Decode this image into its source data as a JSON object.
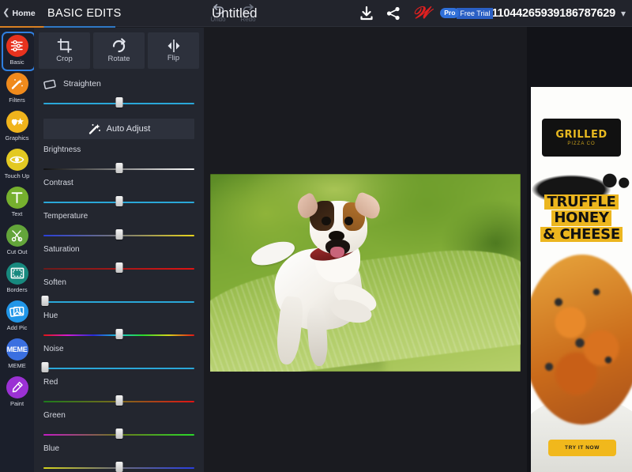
{
  "topbar": {
    "home_label": "Home",
    "home_chevron": "chevron-left-icon",
    "panel_title": "BASIC EDITS",
    "undo_label": "Undo",
    "redo_label": "Redo",
    "document_title": "Untitled",
    "download_icon": "download-icon",
    "share_icon": "share-icon",
    "brand_logo": "w-logo",
    "pro_badge": "Pro",
    "trial_label": "Free Trial",
    "account_number": "111044265939186787629",
    "caret": "chevron-down-icon",
    "accent_orange": "#d98023",
    "accent_blue": "#2f78c4"
  },
  "sidebar": {
    "items": [
      {
        "label": "Basic",
        "icon": "sliders-icon",
        "color": "#e8321e",
        "active": true
      },
      {
        "label": "Filters",
        "icon": "magic-wand-icon",
        "color": "#f08a1c",
        "active": false
      },
      {
        "label": "Graphics",
        "icon": "star-heart-icon",
        "color": "#f0b41c",
        "active": false
      },
      {
        "label": "Touch Up",
        "icon": "eye-icon",
        "color": "#e3c922",
        "active": false
      },
      {
        "label": "Text",
        "icon": "text-t-icon",
        "color": "#76b02e",
        "active": false
      },
      {
        "label": "Cut Out",
        "icon": "scissors-icon",
        "color": "#63a53a",
        "active": false
      },
      {
        "label": "Borders",
        "icon": "frame-icon",
        "color": "#17897e",
        "active": false
      },
      {
        "label": "Add Pic",
        "icon": "photos-icon",
        "color": "#2196e8",
        "active": false
      },
      {
        "label": "MEME",
        "icon": "meme-icon",
        "color": "#3a6fe0",
        "active": false
      },
      {
        "label": "Paint",
        "icon": "paintbrush-icon",
        "color": "#9b31d4",
        "active": false
      }
    ]
  },
  "panel": {
    "tools": [
      {
        "label": "Crop",
        "icon": "crop-icon"
      },
      {
        "label": "Rotate",
        "icon": "rotate-icon"
      },
      {
        "label": "Flip",
        "icon": "flip-icon"
      }
    ],
    "straighten": {
      "label": "Straighten",
      "icon": "straighten-icon",
      "value": 50,
      "track": "solid-blue"
    },
    "auto_adjust": {
      "label": "Auto Adjust",
      "icon": "magic-wand-icon"
    },
    "adjustments": [
      {
        "label": "Brightness",
        "value": 50,
        "gradient": "linear-gradient(to right,#111111,#ffffff)"
      },
      {
        "label": "Contrast",
        "value": 50,
        "gradient": "linear-gradient(to right,#2aa7d8,#2aa7d8)"
      },
      {
        "label": "Temperature",
        "value": 50,
        "gradient": "linear-gradient(to right,#2a3fd8,#777777 50%,#e8d41c)"
      },
      {
        "label": "Saturation",
        "value": 50,
        "gradient": "linear-gradient(to right,#6b1b1b,#e01414)"
      },
      {
        "label": "Soften",
        "value": 1,
        "gradient": "linear-gradient(to right,#2aa7d8,#2aa7d8)"
      },
      {
        "label": "Hue",
        "value": 50,
        "gradient": "linear-gradient(to right,#e01414,#d41ccf 16%,#2a2ad8 33%,#1cc9d4 50%,#2ad82a 66%,#d4d41c 83%,#e01414)"
      },
      {
        "label": "Noise",
        "value": 1,
        "gradient": "linear-gradient(to right,#2aa7d8,#2aa7d8)"
      },
      {
        "label": "Red",
        "value": 50,
        "gradient": "linear-gradient(to right,#1d7a1d,#7a6a1d 50%,#e01414)"
      },
      {
        "label": "Green",
        "value": 50,
        "gradient": "linear-gradient(to right,#c41cc4,#6a7a1d 50%,#2ad82a)"
      },
      {
        "label": "Blue",
        "value": 50,
        "gradient": "linear-gradient(to right,#d4d41c,#6a6a7a 50%,#2a3fe0)"
      }
    ]
  },
  "canvas": {
    "image_alt": "jack-russell-terrier-jumping-on-grass",
    "background": "#1a1b20"
  },
  "ad": {
    "logo_line1": "GRILLED",
    "logo_line2": "PIZZA CO",
    "headline": [
      "TRUFFLE",
      "HONEY",
      "& CHEESE"
    ],
    "cta_label": "TRY IT NOW"
  }
}
